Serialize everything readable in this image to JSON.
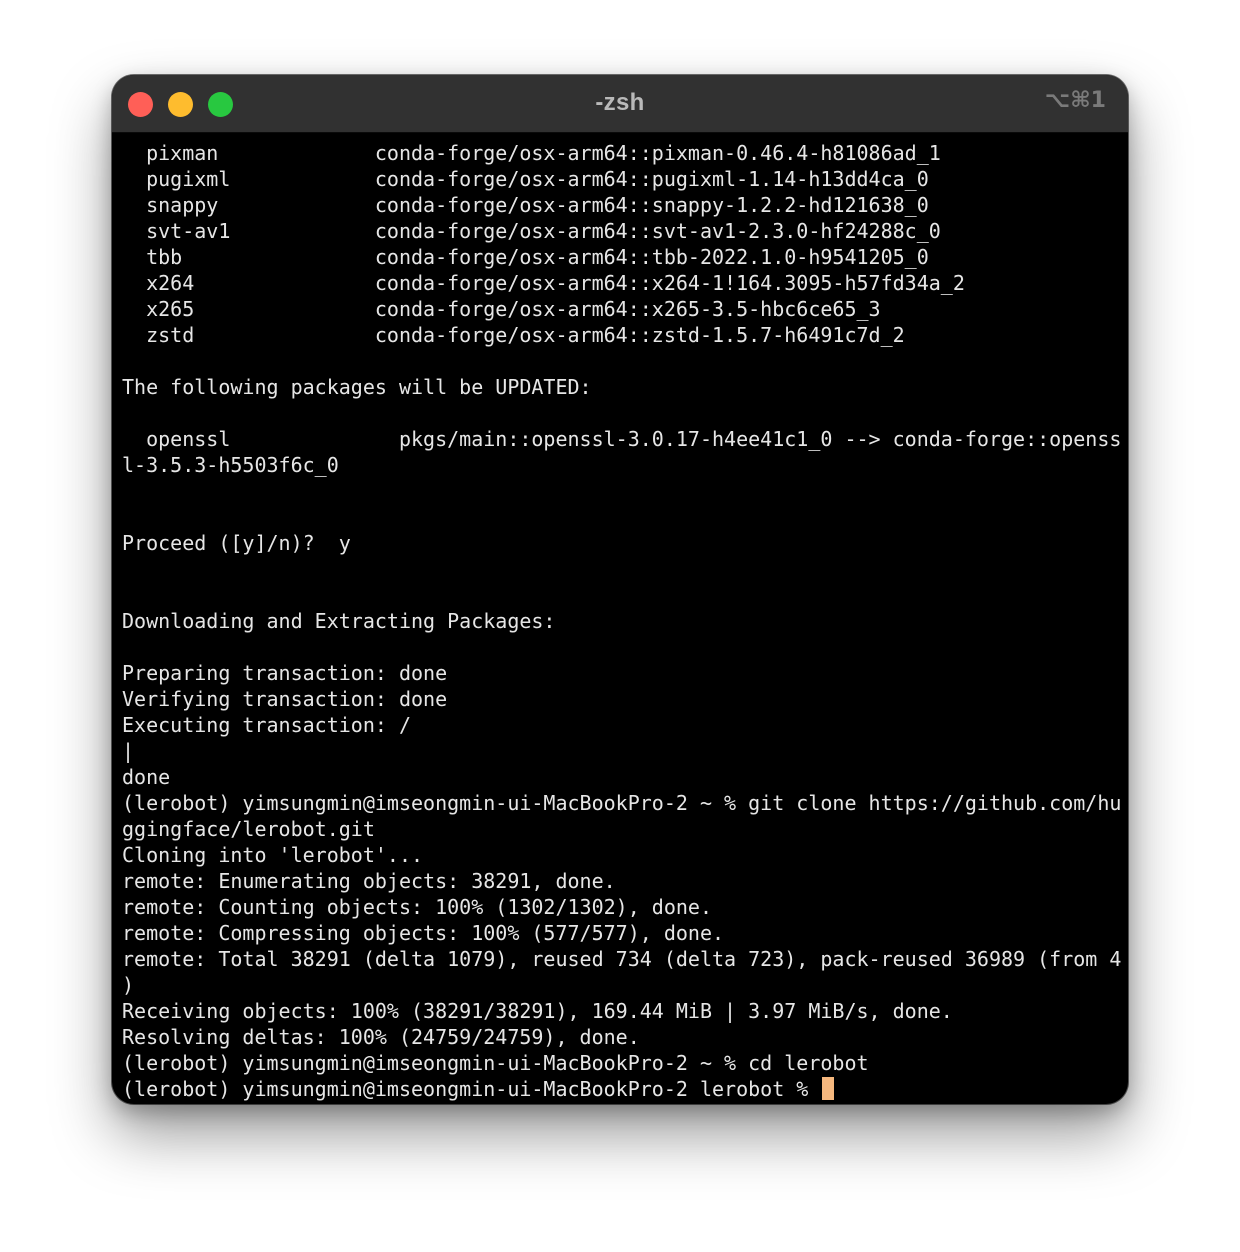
{
  "window": {
    "title": "-zsh",
    "shortcut": "⌥⌘1",
    "colors": {
      "titlebar": "#313131",
      "background": "#000000",
      "text": "#e6e6e6",
      "cursor": "#f6b87e",
      "close": "#ff5f57",
      "minimize": "#febc2e",
      "maximize": "#28c840"
    }
  },
  "terminal": {
    "lines": [
      "  pixman             conda-forge/osx-arm64::pixman-0.46.4-h81086ad_1",
      "  pugixml            conda-forge/osx-arm64::pugixml-1.14-h13dd4ca_0",
      "  snappy             conda-forge/osx-arm64::snappy-1.2.2-hd121638_0",
      "  svt-av1            conda-forge/osx-arm64::svt-av1-2.3.0-hf24288c_0",
      "  tbb                conda-forge/osx-arm64::tbb-2022.1.0-h9541205_0",
      "  x264               conda-forge/osx-arm64::x264-1!164.3095-h57fd34a_2",
      "  x265               conda-forge/osx-arm64::x265-3.5-hbc6ce65_3",
      "  zstd               conda-forge/osx-arm64::zstd-1.5.7-h6491c7d_2",
      "",
      "The following packages will be UPDATED:",
      "",
      "  openssl              pkgs/main::openssl-3.0.17-h4ee41c1_0 --> conda-forge::openss",
      "l-3.5.3-h5503f6c_0",
      "",
      "",
      "Proceed ([y]/n)?  y",
      "",
      "",
      "Downloading and Extracting Packages:",
      "",
      "Preparing transaction: done",
      "Verifying transaction: done",
      "Executing transaction: /",
      "|",
      "done",
      "(lerobot) yimsungmin@imseongmin-ui-MacBookPro-2 ~ % git clone https://github.com/hu",
      "ggingface/lerobot.git",
      "Cloning into 'lerobot'...",
      "remote: Enumerating objects: 38291, done.",
      "remote: Counting objects: 100% (1302/1302), done.",
      "remote: Compressing objects: 100% (577/577), done.",
      "remote: Total 38291 (delta 1079), reused 734 (delta 723), pack-reused 36989 (from 4",
      ")",
      "Receiving objects: 100% (38291/38291), 169.44 MiB | 3.97 MiB/s, done.",
      "Resolving deltas: 100% (24759/24759), done.",
      "(lerobot) yimsungmin@imseongmin-ui-MacBookPro-2 ~ % cd lerobot"
    ],
    "prompt": "(lerobot) yimsungmin@imseongmin-ui-MacBookPro-2 lerobot % "
  }
}
